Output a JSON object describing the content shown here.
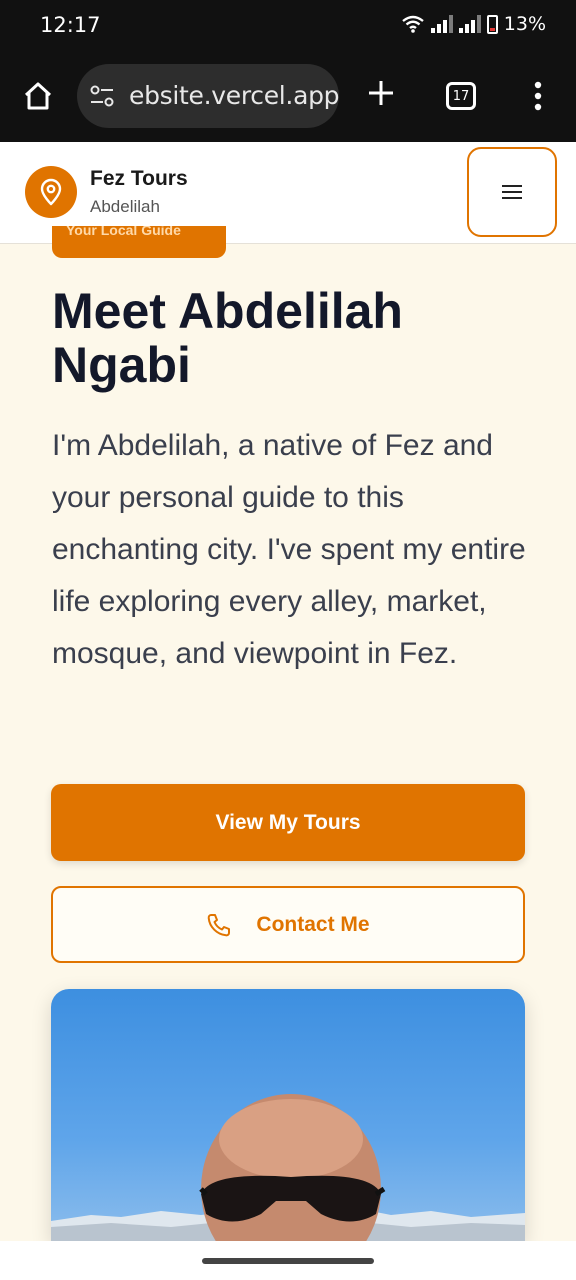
{
  "status_bar": {
    "time": "12:17",
    "battery": "13%"
  },
  "browser": {
    "url": "ebsite.vercel.app",
    "tab_count": "17"
  },
  "header": {
    "brand_title": "Fez Tours",
    "brand_subtitle": "Abdelilah"
  },
  "hero": {
    "badge": "Your Local Guide",
    "title": "Meet Abdelilah Ngabi",
    "description": "I'm Abdelilah, a native of Fez and your personal guide to this enchanting city. I've spent my entire life exploring every alley, market, mosque, and viewpoint in Fez."
  },
  "actions": {
    "primary_label": "View My Tours",
    "secondary_label": "Contact Me"
  },
  "colors": {
    "accent": "#e07400",
    "background": "#fdf8ea",
    "text": "#13182a"
  },
  "icons": [
    "home-icon",
    "site-settings-icon",
    "plus-icon",
    "tabs-icon",
    "more-vert-icon",
    "map-pin-icon",
    "menu-icon",
    "phone-icon"
  ]
}
